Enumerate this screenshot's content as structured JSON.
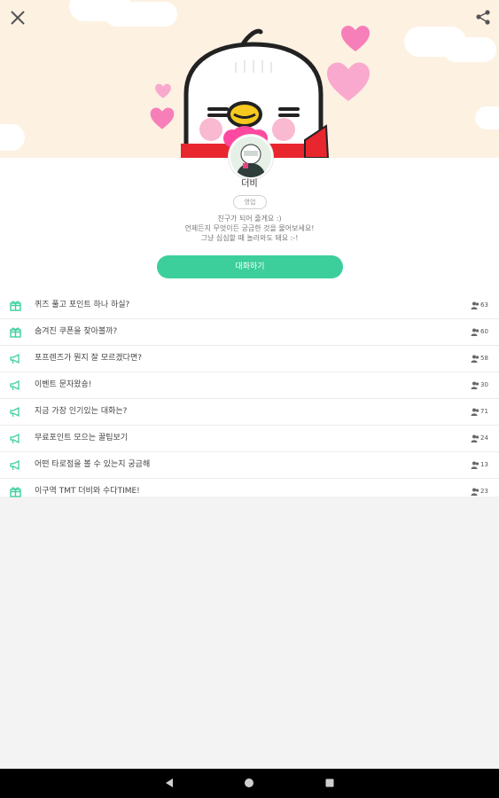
{
  "header": {
    "close_icon": "close-icon",
    "share_icon": "share-icon",
    "colors": {
      "background": "#fdf1e2",
      "heart": "#f77fb9",
      "accent": "#3ccf9c"
    }
  },
  "profile": {
    "name": "더비",
    "status": "영업",
    "intro_lines": [
      "친구가 되어 줄게요 :)",
      "언제든지 무엇이든 궁금한 것을 물어보세요!",
      "그냥 심심할 때 놀러와도 돼요 :-!"
    ],
    "chat_button": "대화하기"
  },
  "rooms": [
    {
      "icon": "gift-icon",
      "title": "퀴즈 풀고 포인트 하나 하실?",
      "count": "63"
    },
    {
      "icon": "gift-icon",
      "title": "숨겨진 쿠폰을 찾아볼까?",
      "count": "60"
    },
    {
      "icon": "megaphone-icon",
      "title": "포프렌즈가 뭔지 잘 모르겠다면?",
      "count": "58"
    },
    {
      "icon": "megaphone-icon",
      "title": "이벤트 문자왔숑!",
      "count": "30"
    },
    {
      "icon": "megaphone-icon",
      "title": "지금 가장 인기있는 대화는?",
      "count": "71"
    },
    {
      "icon": "megaphone-icon",
      "title": "무료포인트 모으는 꿀팁보기",
      "count": "24"
    },
    {
      "icon": "megaphone-icon",
      "title": "어떤 타로점을 볼 수 있는지 궁금해",
      "count": "13"
    },
    {
      "icon": "gift-icon",
      "title": "이구역 TMT 더비와 수다TIME!",
      "count": "23"
    }
  ],
  "navbar": {
    "back_icon": "back-icon",
    "home_icon": "home-icon",
    "recents_icon": "recents-icon"
  }
}
